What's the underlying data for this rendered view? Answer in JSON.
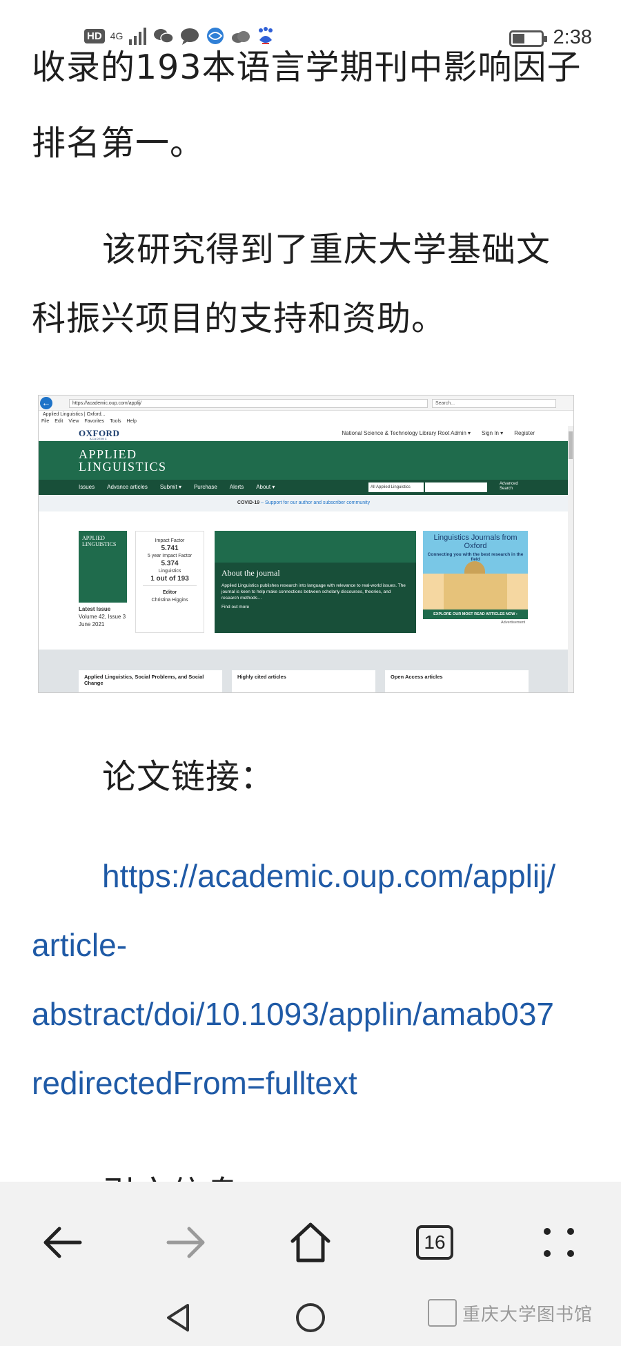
{
  "status_bar": {
    "hd_label": "HD",
    "network_label": "4G",
    "time": "2:38"
  },
  "article": {
    "line1": "收录的193本语言学期刊中影响因子",
    "line2": "排名第一。",
    "para2_line1": "该研究得到了重庆大学基础文",
    "para2_line2": "科振兴项目的支持和资助。",
    "link_label": "论文链接：",
    "link_line1": "https://academic.oup.com/applij/",
    "link_line2": "article-",
    "link_line3": "abstract/doi/10.1093/applin/amab037",
    "link_line4": "redirectedFrom=fulltext",
    "next_heading": "引文信息："
  },
  "screenshot": {
    "address": "https://academic.oup.com/applij/",
    "search_placeholder": "Search...",
    "tab_title": "Applied Linguistics | Oxford...",
    "menu": [
      "File",
      "Edit",
      "View",
      "Favorites",
      "Tools",
      "Help"
    ],
    "logo": "OXFORD",
    "logo_sub": "ACADEMIC",
    "top_links": [
      "National Science & Technology Library Root Admin ▾",
      "Sign In ▾",
      "Register"
    ],
    "journal_title": "APPLIED\nLINGUISTICS",
    "journal_nav": [
      "Issues",
      "Advance articles",
      "Submit ▾",
      "Purchase",
      "Alerts",
      "About ▾"
    ],
    "search_scope": "All Applied Linguistics",
    "advanced_search": "Advanced Search",
    "covid_label": "COVID-19",
    "covid_text": " – Support for our author and subscriber community",
    "cover_title": "APPLIED LINGUISTICS",
    "latest_issue_label": "Latest Issue",
    "latest_issue_volume": "Volume 42, Issue 3",
    "latest_issue_date": "June 2021",
    "impact_factor_label": "Impact Factor",
    "impact_factor": "5.741",
    "five_year_label": "5 year Impact Factor",
    "five_year_factor": "5.374",
    "category_label": "Linguistics",
    "rank": "1 out of 193",
    "editor_label": "Editor",
    "editor_name": "Christina Higgins",
    "about_title": "About the journal",
    "about_text": "Applied Linguistics publishes research into language with relevance to real-world issues. The journal is keen to help make connections between scholarly discourses, theories, and research methods…",
    "find_out_more": "Find out more",
    "ad_title": "Linguistics Journals from Oxford",
    "ad_sub": "Connecting you with the best research in the field",
    "ad_cta": "EXPLORE OUR MOST READ ARTICLES NOW ›",
    "ad_label": "Advertisement",
    "cards": [
      "Applied Linguistics, Social Problems, and Social Change",
      "Highly cited articles",
      "Open Access articles"
    ]
  },
  "toolbar": {
    "tab_count": "16"
  },
  "watermark": {
    "text": "重庆大学图书馆"
  }
}
